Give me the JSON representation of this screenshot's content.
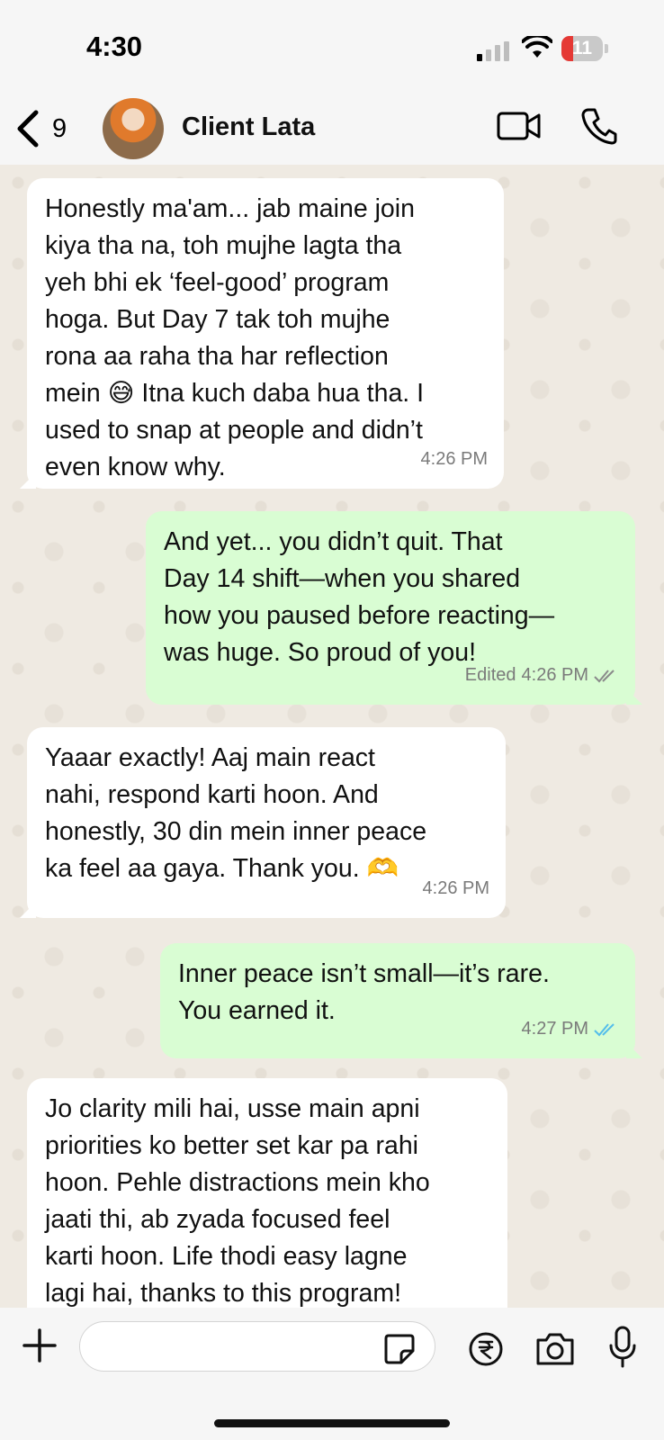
{
  "status_bar": {
    "time": "4:30",
    "battery": "11"
  },
  "header": {
    "back_count": "9",
    "contact_name": "Client Lata"
  },
  "messages": [
    {
      "direction": "incoming",
      "text": "Honestly ma'am... jab maine join\nkiya tha na, toh mujhe lagta tha\nyeh bhi ek ‘feel-good’ program\nhoga. But Day 7 tak toh mujhe\nrona aa raha tha har reflection\nmein 😅 Itna kuch daba hua tha. I\nused to snap at people and didn’t\neven know why.",
      "time": "4:26 PM"
    },
    {
      "direction": "outgoing",
      "text": "And yet... you didn’t quit.  That\nDay 14 shift—when you shared\nhow you paused before reacting—\nwas huge. So proud of you!",
      "edited": "Edited",
      "time": "4:26 PM",
      "status": "read-grey"
    },
    {
      "direction": "incoming",
      "text": "Yaaar exactly! Aaj main react\nnahi, respond karti hoon. And\nhonestly, 30 din mein inner peace\nka feel aa gaya. Thank you. 🫶",
      "time": "4:26 PM"
    },
    {
      "direction": "outgoing",
      "text": "Inner peace isn’t small—it’s rare.\nYou earned it.",
      "time": "4:27 PM",
      "status": "read-blue"
    },
    {
      "direction": "incoming",
      "text": "Jo clarity mili hai, usse main apni\npriorities ko better set kar pa rahi\nhoon. Pehle distractions mein kho\njaati thi, ab zyada focused feel\nkarti hoon. Life thodi easy lagne\nlagi hai, thanks to this program!",
      "time": ""
    }
  ],
  "colors": {
    "incoming_bubble": "#ffffff",
    "outgoing_bubble": "#d9fdd3",
    "chat_background": "#efeae2",
    "read_tick_blue": "#53bdeb",
    "read_tick_grey": "#8a8a8a"
  }
}
